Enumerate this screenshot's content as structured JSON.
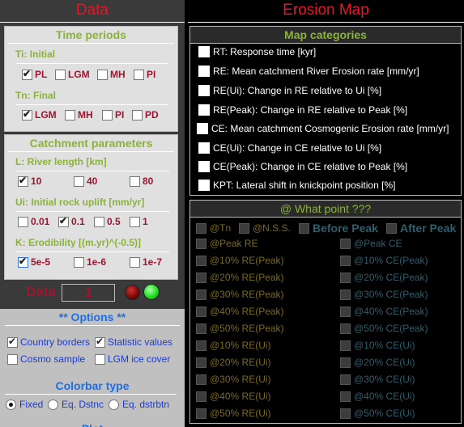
{
  "left_title": "Data",
  "right_title": "Erosion Map",
  "time_periods": {
    "title": "Time periods",
    "initial_label": "Ti: Initial",
    "initial_options": [
      {
        "label": "PL",
        "checked": true
      },
      {
        "label": "LGM",
        "checked": false
      },
      {
        "label": "MH",
        "checked": false
      },
      {
        "label": "PI",
        "checked": false
      }
    ],
    "final_label": "Tn: Final",
    "final_options": [
      {
        "label": "LGM",
        "checked": true
      },
      {
        "label": "MH",
        "checked": false
      },
      {
        "label": "PI",
        "checked": false
      },
      {
        "label": "PD",
        "checked": false
      }
    ]
  },
  "catchment": {
    "title": "Catchment parameters",
    "river_label": "L: River length [km]",
    "river_options": [
      {
        "label": "10",
        "checked": true
      },
      {
        "label": "40",
        "checked": false
      },
      {
        "label": "80",
        "checked": false
      }
    ],
    "uplift_label": "Ui: Initial rock uplift [mm/yr]",
    "uplift_options": [
      {
        "label": "0.01",
        "checked": false
      },
      {
        "label": "0.1",
        "checked": true
      },
      {
        "label": "0.5",
        "checked": false
      },
      {
        "label": "1",
        "checked": false
      }
    ],
    "erod_label": "K: Erodibility [(m.yr)^(-0.5)]",
    "erod_options": [
      {
        "label": "5e-5",
        "checked": true
      },
      {
        "label": "1e-6",
        "checked": false
      },
      {
        "label": "1e-7",
        "checked": false
      }
    ]
  },
  "data_row": {
    "label": "Data",
    "value": "1"
  },
  "options": {
    "title": "** Options **",
    "country_borders": "Country borders",
    "statistic_values": "Statistic values",
    "cosmo_sample": "Cosmo sample",
    "lgm_ice_cover": "LGM ice cover",
    "colorbar_title": "Colorbar type",
    "colorbar_fixed": "Fixed",
    "colorbar_eq_dstnc": "Eq. Dstnc",
    "colorbar_eq_dstrbtn": "Eq. dstrbtn",
    "next_title": "Plot"
  },
  "map_categories": {
    "title": "Map categories",
    "items": [
      "RT: Response time [kyr]",
      "RE: Mean catchment River Erosion rate [mm/yr]",
      "RE(Ui): Change in RE relative to Ui [%]",
      "RE(Peak): Change in RE relative to Peak [%]",
      "CE: Mean catchment Cosmogenic Erosion rate [mm/yr]",
      "CE(Ui): Change in CE relative to Ui [%]",
      "CE(Peak): Change in CE relative to Peak [%]",
      "KPT: Lateral shift in knickpoint position [%]"
    ]
  },
  "what_point": {
    "title": "@ What point ???",
    "top_row": [
      "@Tn",
      "@N.S.S.",
      "Before Peak",
      "After Peak"
    ],
    "left_col": [
      "@Peak RE",
      "@10% RE(Peak)",
      "@20% RE(Peak)",
      "@30% RE(Peak)",
      "@40% RE(Peak)",
      "@50% RE(Peak)",
      "@10% RE(Ui)",
      "@20% RE(Ui)",
      "@30% RE(Ui)",
      "@40% RE(Ui)",
      "@50% RE(Ui)"
    ],
    "right_col": [
      "@Peak CE",
      "@10% CE(Peak)",
      "@20% CE(Peak)",
      "@30% CE(Peak)",
      "@40% CE(Peak)",
      "@50% CE(Peak)",
      "@10% CE(Ui)",
      "@20% CE(Ui)",
      "@30% CE(Ui)",
      "@40% CE(Ui)",
      "@50% CE(Ui)"
    ]
  },
  "colors": {
    "accent_red": "#e8142a",
    "title_green": "#8bb33a",
    "label_crimson": "#a01430",
    "option_blue": "#1a3ad8"
  }
}
